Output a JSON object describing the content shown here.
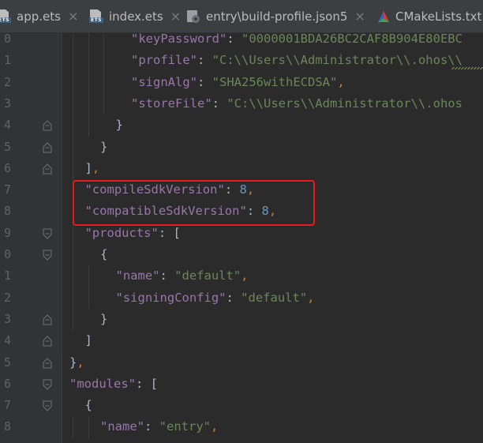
{
  "tabs": [
    {
      "label": "app.ets",
      "icon": "ets-file-icon",
      "closable": true
    },
    {
      "label": "index.ets",
      "icon": "ets-file-icon",
      "closable": true
    },
    {
      "label": "entry\\build-profile.json5",
      "icon": "gear-json-icon",
      "closable": true
    },
    {
      "label": "CMakeLists.txt",
      "icon": "cmake-icon",
      "closable": true
    }
  ],
  "icon_badge": "ETS",
  "close_glyph": "×",
  "gutter": {
    "line_numbers": [
      "0",
      "1",
      "2",
      "3",
      "4",
      "5",
      "6",
      "7",
      "8",
      "9",
      "0",
      "1",
      "2",
      "3",
      "4",
      "5",
      "6",
      "7",
      "8"
    ]
  },
  "code": {
    "lines": [
      {
        "indent": 5,
        "tokens": [
          {
            "t": "\"keyPassword\"",
            "c": "k"
          },
          {
            "t": ": ",
            "c": "p"
          },
          {
            "t": "\"0000001BDA26BC2CAF8B904E80EBC",
            "c": "s"
          }
        ]
      },
      {
        "indent": 5,
        "tokens": [
          {
            "t": "\"profile\"",
            "c": "k"
          },
          {
            "t": ": ",
            "c": "p"
          },
          {
            "t": "\"C:\\\\Users\\\\Administrator\\\\.ohos\\\\",
            "c": "s"
          }
        ]
      },
      {
        "indent": 5,
        "tokens": [
          {
            "t": "\"signAlg\"",
            "c": "k"
          },
          {
            "t": ": ",
            "c": "p"
          },
          {
            "t": "\"SHA256withECDSA\"",
            "c": "s"
          },
          {
            "t": ",",
            "c": "c"
          }
        ]
      },
      {
        "indent": 5,
        "tokens": [
          {
            "t": "\"storeFile\"",
            "c": "k"
          },
          {
            "t": ": ",
            "c": "p"
          },
          {
            "t": "\"C:\\\\Users\\\\Administrator\\\\.ohos",
            "c": "s"
          }
        ]
      },
      {
        "indent": 4,
        "tokens": [
          {
            "t": "}",
            "c": "p"
          }
        ]
      },
      {
        "indent": 3,
        "tokens": [
          {
            "t": "}",
            "c": "p"
          }
        ]
      },
      {
        "indent": 2,
        "tokens": [
          {
            "t": "]",
            "c": "p"
          },
          {
            "t": ",",
            "c": "c"
          }
        ]
      },
      {
        "indent": 2,
        "tokens": [
          {
            "t": "\"compileSdkVersion\"",
            "c": "k"
          },
          {
            "t": ": ",
            "c": "p"
          },
          {
            "t": "8",
            "c": "n"
          },
          {
            "t": ",",
            "c": "c"
          }
        ]
      },
      {
        "indent": 2,
        "tokens": [
          {
            "t": "\"compatibleSdkVersion\"",
            "c": "k"
          },
          {
            "t": ": ",
            "c": "p"
          },
          {
            "t": "8",
            "c": "n"
          },
          {
            "t": ",",
            "c": "c"
          }
        ]
      },
      {
        "indent": 2,
        "tokens": [
          {
            "t": "\"products\"",
            "c": "k"
          },
          {
            "t": ": ",
            "c": "p"
          },
          {
            "t": "[",
            "c": "p"
          }
        ]
      },
      {
        "indent": 3,
        "tokens": [
          {
            "t": "{",
            "c": "p"
          }
        ]
      },
      {
        "indent": 4,
        "tokens": [
          {
            "t": "\"name\"",
            "c": "k"
          },
          {
            "t": ": ",
            "c": "p"
          },
          {
            "t": "\"default\"",
            "c": "s"
          },
          {
            "t": ",",
            "c": "c"
          }
        ]
      },
      {
        "indent": 4,
        "tokens": [
          {
            "t": "\"signingConfig\"",
            "c": "k"
          },
          {
            "t": ": ",
            "c": "p"
          },
          {
            "t": "\"default\"",
            "c": "s"
          },
          {
            "t": ",",
            "c": "c"
          }
        ]
      },
      {
        "indent": 3,
        "tokens": [
          {
            "t": "}",
            "c": "p"
          }
        ]
      },
      {
        "indent": 2,
        "tokens": [
          {
            "t": "]",
            "c": "p"
          }
        ]
      },
      {
        "indent": 1,
        "tokens": [
          {
            "t": "}",
            "c": "p"
          },
          {
            "t": ",",
            "c": "c"
          }
        ]
      },
      {
        "indent": 1,
        "tokens": [
          {
            "t": "\"modules\"",
            "c": "k"
          },
          {
            "t": ": ",
            "c": "p"
          },
          {
            "t": "[",
            "c": "p"
          }
        ]
      },
      {
        "indent": 2,
        "tokens": [
          {
            "t": "{",
            "c": "p"
          }
        ]
      },
      {
        "indent": 3,
        "tokens": [
          {
            "t": "\"name\"",
            "c": "k"
          },
          {
            "t": ": ",
            "c": "p"
          },
          {
            "t": "\"entry\"",
            "c": "s"
          },
          {
            "t": ",",
            "c": "c"
          }
        ]
      }
    ]
  },
  "highlighted_lines": [
    7,
    8
  ],
  "colors": {
    "background": "#2b2b2b",
    "key": "#9876aa",
    "string": "#6a8759",
    "number": "#6897bb",
    "punctuation": "#a9b7c6",
    "comma": "#cc7832",
    "highlight_border": "#e81a1a"
  }
}
